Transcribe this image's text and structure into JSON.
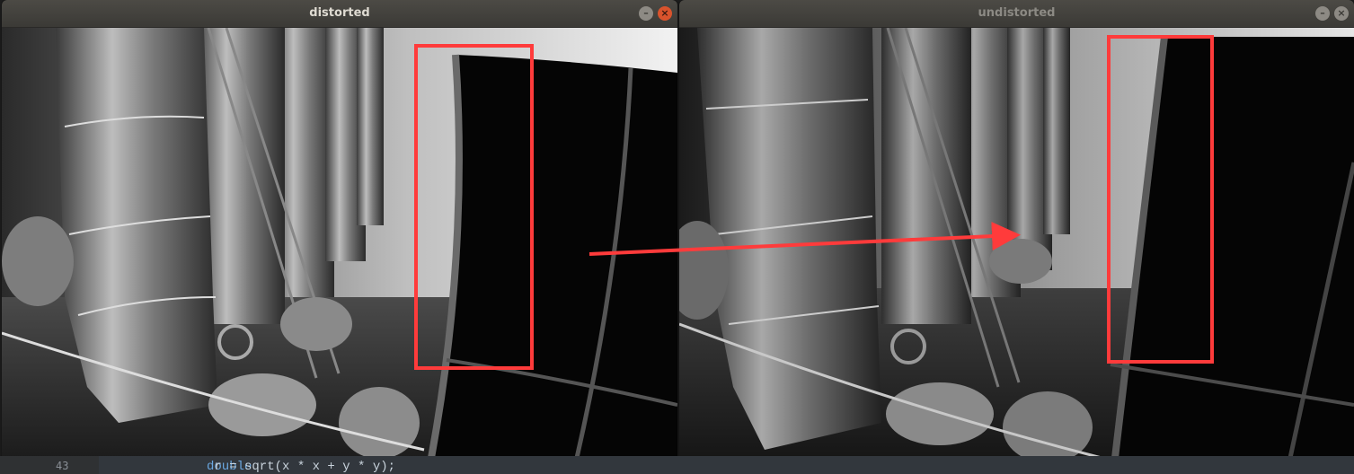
{
  "windows": {
    "left": {
      "title": "distorted",
      "minimize_glyph": "–",
      "close_glyph": "×",
      "image": "distorted industrial tank room image"
    },
    "right": {
      "title": "undistorted",
      "minimize_glyph": "–",
      "close_glyph": "×",
      "image": "undistorted industrial tank room image"
    }
  },
  "annotations": {
    "box_color": "#ff3b3b",
    "arrow_color": "#ff3b3b"
  },
  "editor": {
    "line_number": "43",
    "code_keyword": "double",
    "code_rest": " r = sqrt(x * x + y * y);"
  }
}
